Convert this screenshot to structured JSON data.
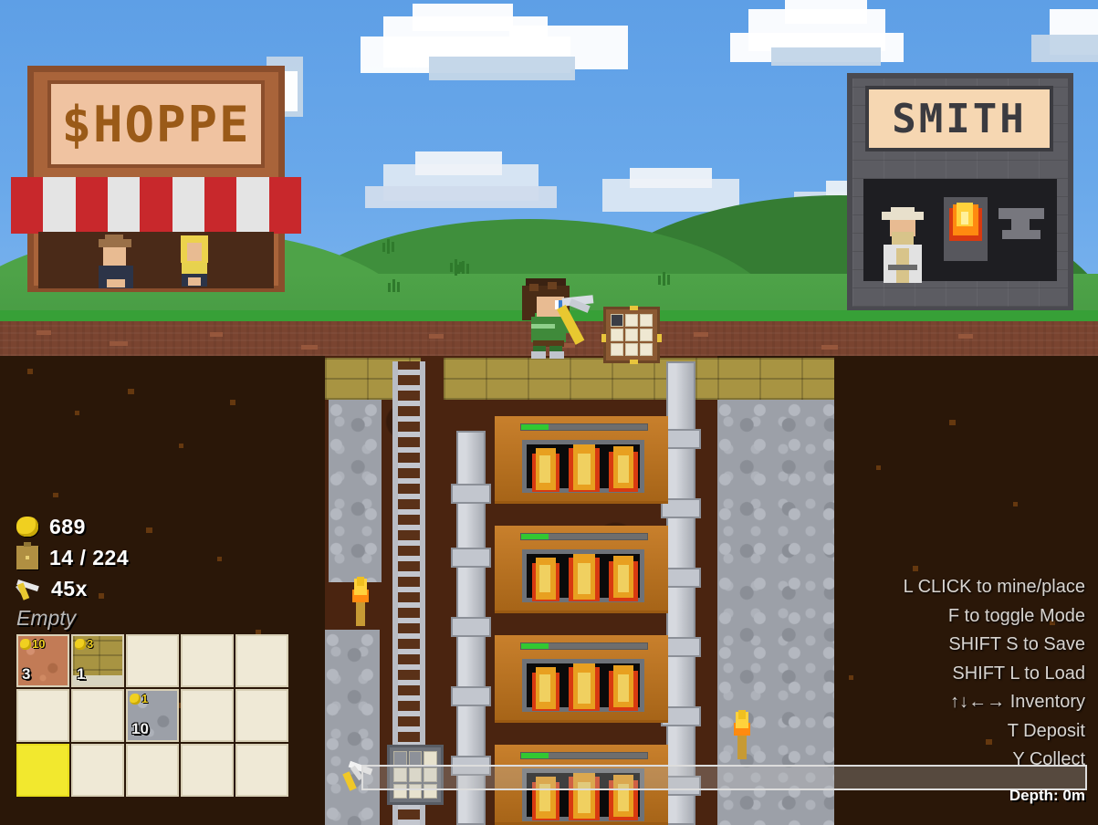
{
  "game": {
    "title": "Pixel Mining Game"
  },
  "world": {
    "shop": {
      "sign_text": "$HOPPE",
      "awning_colors": [
        "#c8282c",
        "#e4e4e4"
      ],
      "npcs": [
        "shopkeeper-hat",
        "shopkeeper-blonde"
      ]
    },
    "smith": {
      "sign_text": "SMITH",
      "npc": "blacksmith",
      "features": [
        "forge-fire",
        "anvil"
      ]
    },
    "sky_color": "#5e9fe6",
    "grass_color": "#37a037",
    "dirt_color": "#7a4430",
    "underground_color": "#2a1708"
  },
  "hud": {
    "gold": {
      "icon": "gold-coin-icon",
      "value": "689"
    },
    "capacity": {
      "icon": "backpack-icon",
      "value": "14 / 224"
    },
    "pickaxe": {
      "icon": "pickaxe-icon",
      "value": "45x"
    },
    "selection_label": "Empty",
    "inventory": {
      "columns": 5,
      "rows": 3,
      "selected_index": 10,
      "slots": [
        {
          "index": 0,
          "item": "clay",
          "texture": "clay",
          "price": "10",
          "qty": "3",
          "empty": false
        },
        {
          "index": 1,
          "item": "sandstone-brick",
          "texture": "sand",
          "price": "3",
          "qty": "1",
          "empty": false
        },
        {
          "index": 2,
          "item": null,
          "texture": "",
          "price": "",
          "qty": "",
          "empty": true
        },
        {
          "index": 3,
          "item": null,
          "texture": "",
          "price": "",
          "qty": "",
          "empty": true
        },
        {
          "index": 4,
          "item": null,
          "texture": "",
          "price": "",
          "qty": "",
          "empty": true
        },
        {
          "index": 5,
          "item": null,
          "texture": "",
          "price": "",
          "qty": "",
          "empty": true
        },
        {
          "index": 6,
          "item": null,
          "texture": "",
          "price": "",
          "qty": "",
          "empty": true
        },
        {
          "index": 7,
          "item": "stone",
          "texture": "stone",
          "price": "1",
          "qty": "10",
          "empty": false
        },
        {
          "index": 8,
          "item": null,
          "texture": "",
          "price": "",
          "qty": "",
          "empty": true
        },
        {
          "index": 9,
          "item": null,
          "texture": "",
          "price": "",
          "qty": "",
          "empty": true
        },
        {
          "index": 10,
          "item": null,
          "texture": "",
          "price": "",
          "qty": "",
          "empty": true
        },
        {
          "index": 11,
          "item": null,
          "texture": "",
          "price": "",
          "qty": "",
          "empty": true
        },
        {
          "index": 12,
          "item": null,
          "texture": "",
          "price": "",
          "qty": "",
          "empty": true
        },
        {
          "index": 13,
          "item": null,
          "texture": "",
          "price": "",
          "qty": "",
          "empty": true
        },
        {
          "index": 14,
          "item": null,
          "texture": "",
          "price": "",
          "qty": "",
          "empty": true
        }
      ]
    }
  },
  "controls": [
    "L CLICK to mine/place",
    "F to toggle Mode",
    "SHIFT S to Save",
    "SHIFT L to Load",
    "↑↓←→ Inventory",
    "T Deposit",
    "Y Collect"
  ],
  "depth": {
    "label": "Depth: 0m",
    "value": 0,
    "unit": "m",
    "icon": "pickaxe-icon"
  },
  "machines": {
    "furnaces": [
      {
        "index": 0,
        "progress_percent": 22,
        "bar_color": "#32c832"
      },
      {
        "index": 1,
        "progress_percent": 22,
        "bar_color": "#32c832"
      },
      {
        "index": 2,
        "progress_percent": 22,
        "bar_color": "#32c832"
      },
      {
        "index": 3,
        "progress_percent": 22,
        "bar_color": "#32c832"
      }
    ],
    "crafting_tables": 2,
    "torches": 2
  },
  "colors": {
    "accent_gold": "#f0d020",
    "selection_yellow": "#f2e82e",
    "progress_green": "#32c832",
    "furnace_orange": "#c4761c",
    "stone_grey": "#9ca0a8",
    "brick_gold": "#a89442"
  }
}
